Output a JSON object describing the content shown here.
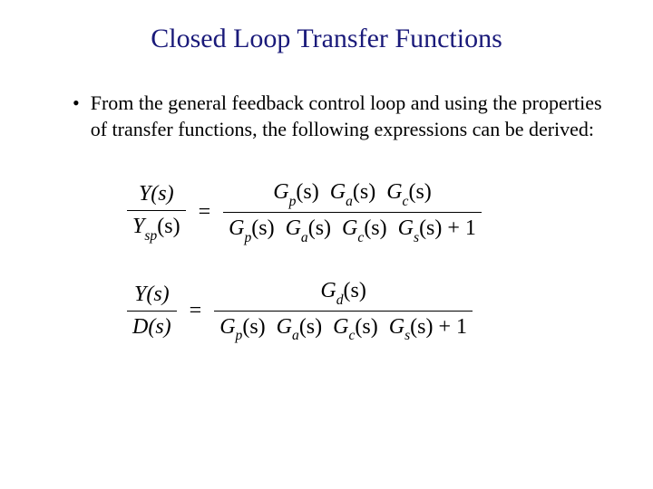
{
  "title": "Closed Loop Transfer Functions",
  "bullet": {
    "marker": "•",
    "text": "From the general feedback control loop and using the properties of transfer functions, the following expressions can be derived:"
  },
  "eq1": {
    "left_num": "Y(s)",
    "left_den_var": "Y",
    "left_den_sub": "sp",
    "left_den_arg": "(s)",
    "equals": "=",
    "r_num_g1": "G",
    "r_num_g1_sub": "p",
    "r_num_g1_arg": "(s)",
    "r_num_g2": "G",
    "r_num_g2_sub": "a",
    "r_num_g2_arg": "(s)",
    "r_num_g3": "G",
    "r_num_g3_sub": "c",
    "r_num_g3_arg": "(s)",
    "r_den_g1": "G",
    "r_den_g1_sub": "p",
    "r_den_g1_arg": "(s)",
    "r_den_g2": "G",
    "r_den_g2_sub": "a",
    "r_den_g2_arg": "(s)",
    "r_den_g3": "G",
    "r_den_g3_sub": "c",
    "r_den_g3_arg": "(s)",
    "r_den_g4": "G",
    "r_den_g4_sub": "s",
    "r_den_g4_arg": "(s)",
    "r_den_tail": " + 1"
  },
  "eq2": {
    "left_num": "Y(s)",
    "left_den": "D(s)",
    "equals": "=",
    "r_num_g1": "G",
    "r_num_g1_sub": "d",
    "r_num_g1_arg": "(s)",
    "r_den_g1": "G",
    "r_den_g1_sub": "p",
    "r_den_g1_arg": "(s)",
    "r_den_g2": "G",
    "r_den_g2_sub": "a",
    "r_den_g2_arg": "(s)",
    "r_den_g3": "G",
    "r_den_g3_sub": "c",
    "r_den_g3_arg": "(s)",
    "r_den_g4": "G",
    "r_den_g4_sub": "s",
    "r_den_g4_arg": "(s)",
    "r_den_tail": " + 1"
  }
}
